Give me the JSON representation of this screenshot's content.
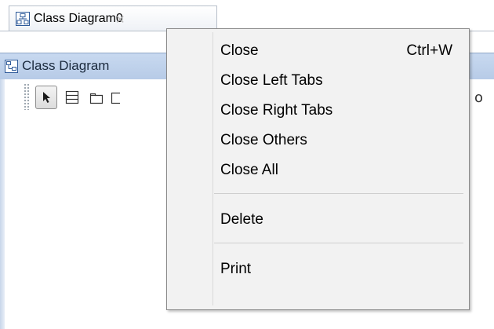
{
  "tab": {
    "title": "Class Diagram0",
    "close_glyph": "✕",
    "icon": "class-diagram-icon"
  },
  "editor": {
    "title": "Class Diagram",
    "icon": "diagram-frame-icon",
    "toolbar": {
      "tools": [
        {
          "name": "select-tool",
          "icon": "arrow-pointer-icon",
          "selected": true
        },
        {
          "name": "class-tool",
          "icon": "class-box-icon",
          "selected": false
        },
        {
          "name": "package-tool",
          "icon": "folder-package-icon",
          "selected": false
        },
        {
          "name": "partial-tool",
          "icon": "box-icon",
          "selected": false
        }
      ],
      "trailing_glyph": "o"
    }
  },
  "context_menu": {
    "items": [
      {
        "label": "Close",
        "shortcut": "Ctrl+W"
      },
      {
        "label": "Close Left Tabs",
        "shortcut": ""
      },
      {
        "label": "Close Right Tabs",
        "shortcut": ""
      },
      {
        "label": "Close Others",
        "shortcut": ""
      },
      {
        "label": "Close All",
        "shortcut": ""
      },
      {
        "label": "Delete",
        "shortcut": ""
      },
      {
        "label": "Print",
        "shortcut": ""
      }
    ]
  },
  "colors": {
    "titlebar": "#b7cbe7",
    "menu_background": "#f2f2f2",
    "menu_border": "#8a8a8a"
  }
}
